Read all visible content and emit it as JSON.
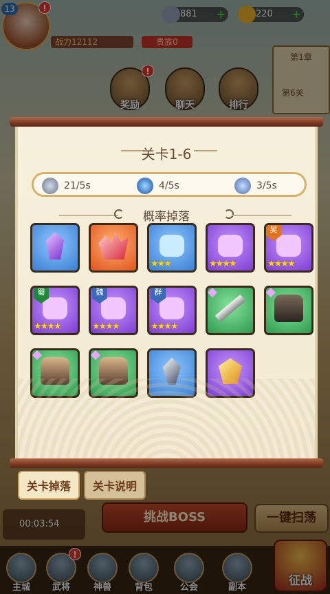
{
  "player": {
    "level": "13",
    "power": "战力12112",
    "clan": "贵族0",
    "notification_badge": "!"
  },
  "resources": {
    "silver": "881",
    "gold": "220",
    "plus": "+"
  },
  "hud_buttons": {
    "reward": "奖励",
    "chat": "聊天",
    "rank": "排行"
  },
  "stage_card": {
    "chapter": "第1章",
    "stage": "第6关"
  },
  "modal": {
    "title": "关卡1-6",
    "stats": [
      {
        "icon": "coin-icon",
        "value": "21/5s"
      },
      {
        "icon": "orb-icon",
        "value": "4/5s"
      },
      {
        "icon": "exp-icon",
        "value": "3/5s"
      }
    ],
    "section_title": "概率掉落",
    "items": [
      {
        "name": "purple-crystal",
        "rarity": "blue",
        "stars": "",
        "faction": ""
      },
      {
        "name": "red-crystal-cluster",
        "rarity": "orange",
        "stars": "",
        "faction": ""
      },
      {
        "name": "blue-puzzle-fragment",
        "rarity": "blue",
        "stars": "★★★",
        "faction": ""
      },
      {
        "name": "purple-puzzle-fragment",
        "rarity": "purple",
        "stars": "★★★★",
        "faction": ""
      },
      {
        "name": "purple-puzzle-fragment-wu",
        "rarity": "purple",
        "stars": "★★★★",
        "faction": "吴"
      },
      {
        "name": "purple-puzzle-fragment-shu",
        "rarity": "purple",
        "stars": "★★★★",
        "faction": "蜀"
      },
      {
        "name": "purple-puzzle-fragment-wei",
        "rarity": "purple",
        "stars": "★★★★",
        "faction": "魏"
      },
      {
        "name": "purple-puzzle-fragment-qun",
        "rarity": "purple",
        "stars": "★★★★",
        "faction": "群"
      },
      {
        "name": "sword",
        "rarity": "green",
        "stars": "",
        "faction": ""
      },
      {
        "name": "armor",
        "rarity": "green",
        "stars": "",
        "faction": ""
      },
      {
        "name": "cloak-armor",
        "rarity": "green",
        "stars": "",
        "faction": ""
      },
      {
        "name": "boots-armor",
        "rarity": "green",
        "stars": "",
        "faction": ""
      },
      {
        "name": "ice-crystal",
        "rarity": "blue",
        "stars": "",
        "faction": ""
      },
      {
        "name": "gold-crystal",
        "rarity": "purple",
        "stars": "",
        "faction": ""
      }
    ]
  },
  "tabs": {
    "drops": "关卡掉落",
    "info": "关卡说明"
  },
  "battle": {
    "timer": "00:03:54",
    "boss_button": "挑战BOSS",
    "sweep_button": "一键扫荡"
  },
  "nav": {
    "items": [
      "主城",
      "武将",
      "神兽",
      "背包",
      "公会",
      "副本"
    ],
    "fight": "征战"
  },
  "colors": {
    "accent_gold": "#d9b06a",
    "title_brown": "#6b4a32",
    "star_yellow": "#ffd21f"
  }
}
